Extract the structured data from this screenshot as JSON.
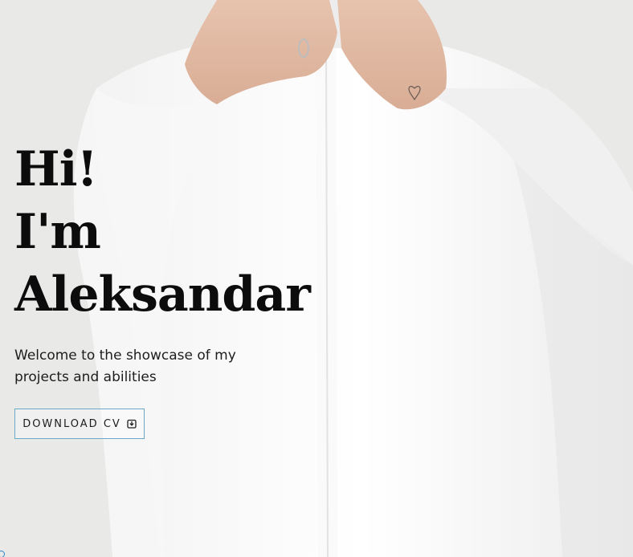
{
  "hero": {
    "headline_line1": "Hi!",
    "headline_line2": "I'm",
    "headline_line3": "Aleksandar",
    "tagline": "Welcome to the showcase of my projects and abilities",
    "button_label": "DOWNLOAD CV",
    "button_icon": "download-icon"
  },
  "colors": {
    "background": "#e9e9e8",
    "text": "#0c0c0c",
    "button_border": "#6aa8c8"
  }
}
